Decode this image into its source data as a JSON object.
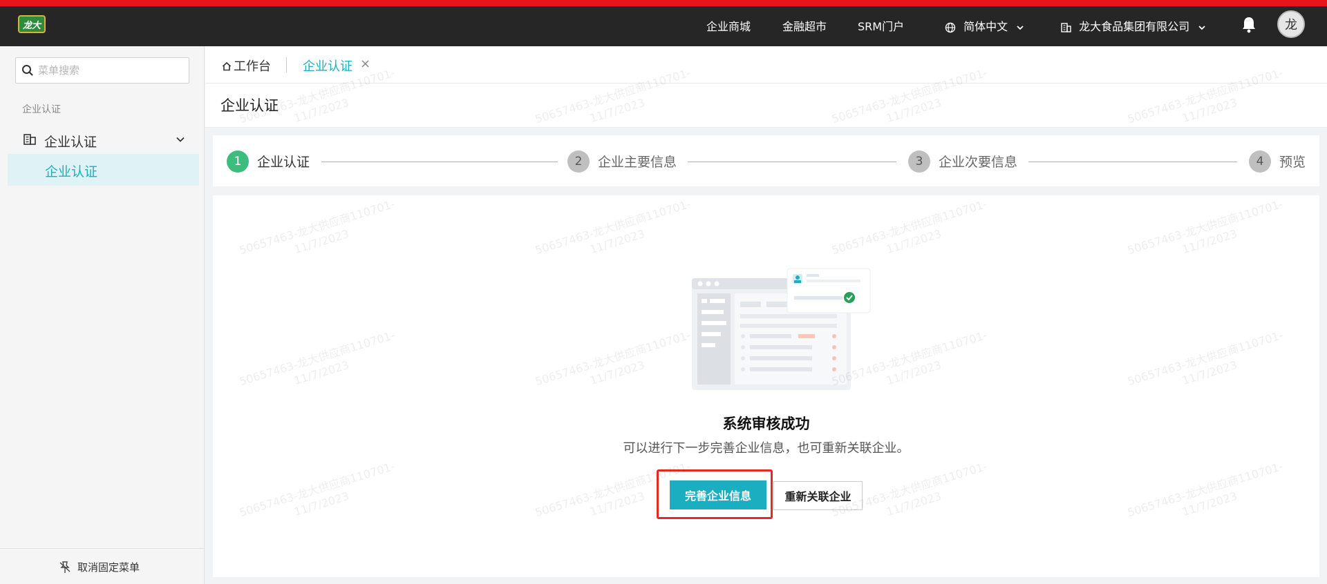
{
  "topbar": {
    "logo_text": "龙大",
    "links": [
      "企业商城",
      "金融超市",
      "SRM门户"
    ],
    "language": "简体中文",
    "company": "龙大食品集团有限公司",
    "avatar_text": "龙",
    "accent_color": "#e8141b"
  },
  "sidebar": {
    "search_placeholder": "菜单搜索",
    "group_label": "企业认证",
    "menu_label": "企业认证",
    "submenu_label": "企业认证",
    "footer_label": "取消固定菜单"
  },
  "tabs": {
    "home_label": "工作台",
    "active_label": "企业认证",
    "close_glyph": "×"
  },
  "page_title": "企业认证",
  "steps": [
    {
      "number": "1",
      "label": "企业认证",
      "status": "active"
    },
    {
      "number": "2",
      "label": "企业主要信息",
      "status": "pending"
    },
    {
      "number": "3",
      "label": "企业次要信息",
      "status": "pending"
    },
    {
      "number": "4",
      "label": "预览",
      "status": "pending"
    }
  ],
  "result": {
    "title": "系统审核成功",
    "description": "可以进行下一步完善企业信息，也可重新关联企业。",
    "primary_button": "完善企业信息",
    "secondary_button": "重新关联企业"
  },
  "watermark": {
    "line1": "50657463-龙大供应商110701-",
    "line2": "11/7/2023"
  },
  "colors": {
    "primary": "#1aaec0",
    "step_active": "#3dbd7d",
    "step_pending": "#bfbfbf",
    "highlight": "#e62a22"
  }
}
